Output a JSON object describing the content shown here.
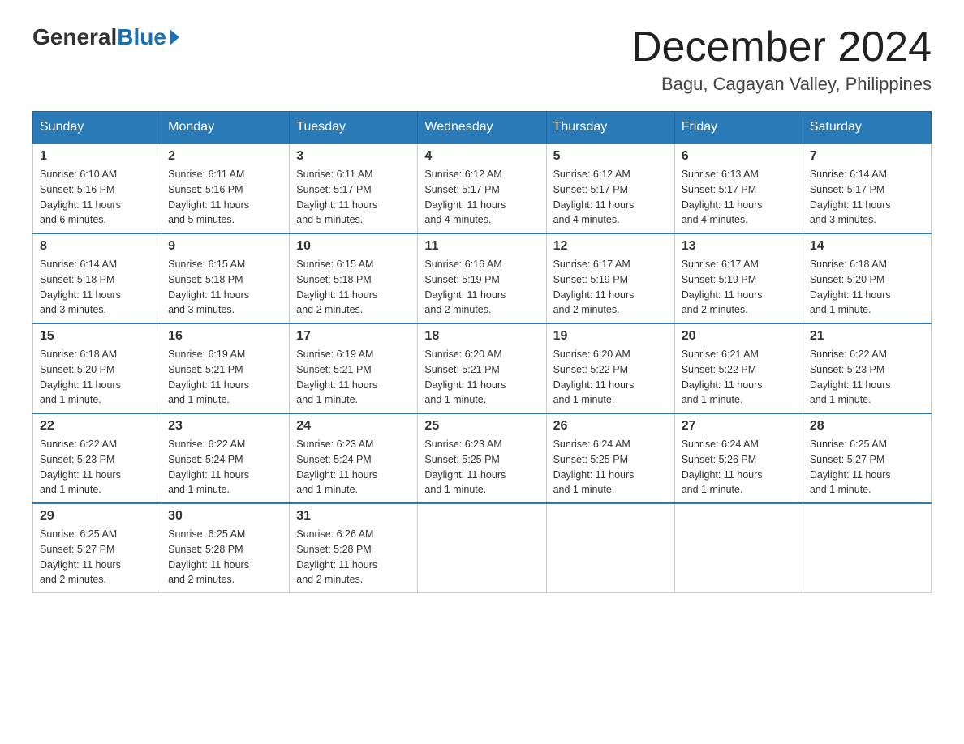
{
  "header": {
    "logo": {
      "general": "General",
      "blue": "Blue"
    },
    "title": "December 2024",
    "location": "Bagu, Cagayan Valley, Philippines"
  },
  "days_of_week": [
    "Sunday",
    "Monday",
    "Tuesday",
    "Wednesday",
    "Thursday",
    "Friday",
    "Saturday"
  ],
  "weeks": [
    [
      {
        "day": "1",
        "sunrise": "6:10 AM",
        "sunset": "5:16 PM",
        "daylight": "11 hours and 6 minutes."
      },
      {
        "day": "2",
        "sunrise": "6:11 AM",
        "sunset": "5:16 PM",
        "daylight": "11 hours and 5 minutes."
      },
      {
        "day": "3",
        "sunrise": "6:11 AM",
        "sunset": "5:17 PM",
        "daylight": "11 hours and 5 minutes."
      },
      {
        "day": "4",
        "sunrise": "6:12 AM",
        "sunset": "5:17 PM",
        "daylight": "11 hours and 4 minutes."
      },
      {
        "day": "5",
        "sunrise": "6:12 AM",
        "sunset": "5:17 PM",
        "daylight": "11 hours and 4 minutes."
      },
      {
        "day": "6",
        "sunrise": "6:13 AM",
        "sunset": "5:17 PM",
        "daylight": "11 hours and 4 minutes."
      },
      {
        "day": "7",
        "sunrise": "6:14 AM",
        "sunset": "5:17 PM",
        "daylight": "11 hours and 3 minutes."
      }
    ],
    [
      {
        "day": "8",
        "sunrise": "6:14 AM",
        "sunset": "5:18 PM",
        "daylight": "11 hours and 3 minutes."
      },
      {
        "day": "9",
        "sunrise": "6:15 AM",
        "sunset": "5:18 PM",
        "daylight": "11 hours and 3 minutes."
      },
      {
        "day": "10",
        "sunrise": "6:15 AM",
        "sunset": "5:18 PM",
        "daylight": "11 hours and 2 minutes."
      },
      {
        "day": "11",
        "sunrise": "6:16 AM",
        "sunset": "5:19 PM",
        "daylight": "11 hours and 2 minutes."
      },
      {
        "day": "12",
        "sunrise": "6:17 AM",
        "sunset": "5:19 PM",
        "daylight": "11 hours and 2 minutes."
      },
      {
        "day": "13",
        "sunrise": "6:17 AM",
        "sunset": "5:19 PM",
        "daylight": "11 hours and 2 minutes."
      },
      {
        "day": "14",
        "sunrise": "6:18 AM",
        "sunset": "5:20 PM",
        "daylight": "11 hours and 1 minute."
      }
    ],
    [
      {
        "day": "15",
        "sunrise": "6:18 AM",
        "sunset": "5:20 PM",
        "daylight": "11 hours and 1 minute."
      },
      {
        "day": "16",
        "sunrise": "6:19 AM",
        "sunset": "5:21 PM",
        "daylight": "11 hours and 1 minute."
      },
      {
        "day": "17",
        "sunrise": "6:19 AM",
        "sunset": "5:21 PM",
        "daylight": "11 hours and 1 minute."
      },
      {
        "day": "18",
        "sunrise": "6:20 AM",
        "sunset": "5:21 PM",
        "daylight": "11 hours and 1 minute."
      },
      {
        "day": "19",
        "sunrise": "6:20 AM",
        "sunset": "5:22 PM",
        "daylight": "11 hours and 1 minute."
      },
      {
        "day": "20",
        "sunrise": "6:21 AM",
        "sunset": "5:22 PM",
        "daylight": "11 hours and 1 minute."
      },
      {
        "day": "21",
        "sunrise": "6:22 AM",
        "sunset": "5:23 PM",
        "daylight": "11 hours and 1 minute."
      }
    ],
    [
      {
        "day": "22",
        "sunrise": "6:22 AM",
        "sunset": "5:23 PM",
        "daylight": "11 hours and 1 minute."
      },
      {
        "day": "23",
        "sunrise": "6:22 AM",
        "sunset": "5:24 PM",
        "daylight": "11 hours and 1 minute."
      },
      {
        "day": "24",
        "sunrise": "6:23 AM",
        "sunset": "5:24 PM",
        "daylight": "11 hours and 1 minute."
      },
      {
        "day": "25",
        "sunrise": "6:23 AM",
        "sunset": "5:25 PM",
        "daylight": "11 hours and 1 minute."
      },
      {
        "day": "26",
        "sunrise": "6:24 AM",
        "sunset": "5:25 PM",
        "daylight": "11 hours and 1 minute."
      },
      {
        "day": "27",
        "sunrise": "6:24 AM",
        "sunset": "5:26 PM",
        "daylight": "11 hours and 1 minute."
      },
      {
        "day": "28",
        "sunrise": "6:25 AM",
        "sunset": "5:27 PM",
        "daylight": "11 hours and 1 minute."
      }
    ],
    [
      {
        "day": "29",
        "sunrise": "6:25 AM",
        "sunset": "5:27 PM",
        "daylight": "11 hours and 2 minutes."
      },
      {
        "day": "30",
        "sunrise": "6:25 AM",
        "sunset": "5:28 PM",
        "daylight": "11 hours and 2 minutes."
      },
      {
        "day": "31",
        "sunrise": "6:26 AM",
        "sunset": "5:28 PM",
        "daylight": "11 hours and 2 minutes."
      },
      null,
      null,
      null,
      null
    ]
  ],
  "labels": {
    "sunrise": "Sunrise:",
    "sunset": "Sunset:",
    "daylight": "Daylight:"
  }
}
